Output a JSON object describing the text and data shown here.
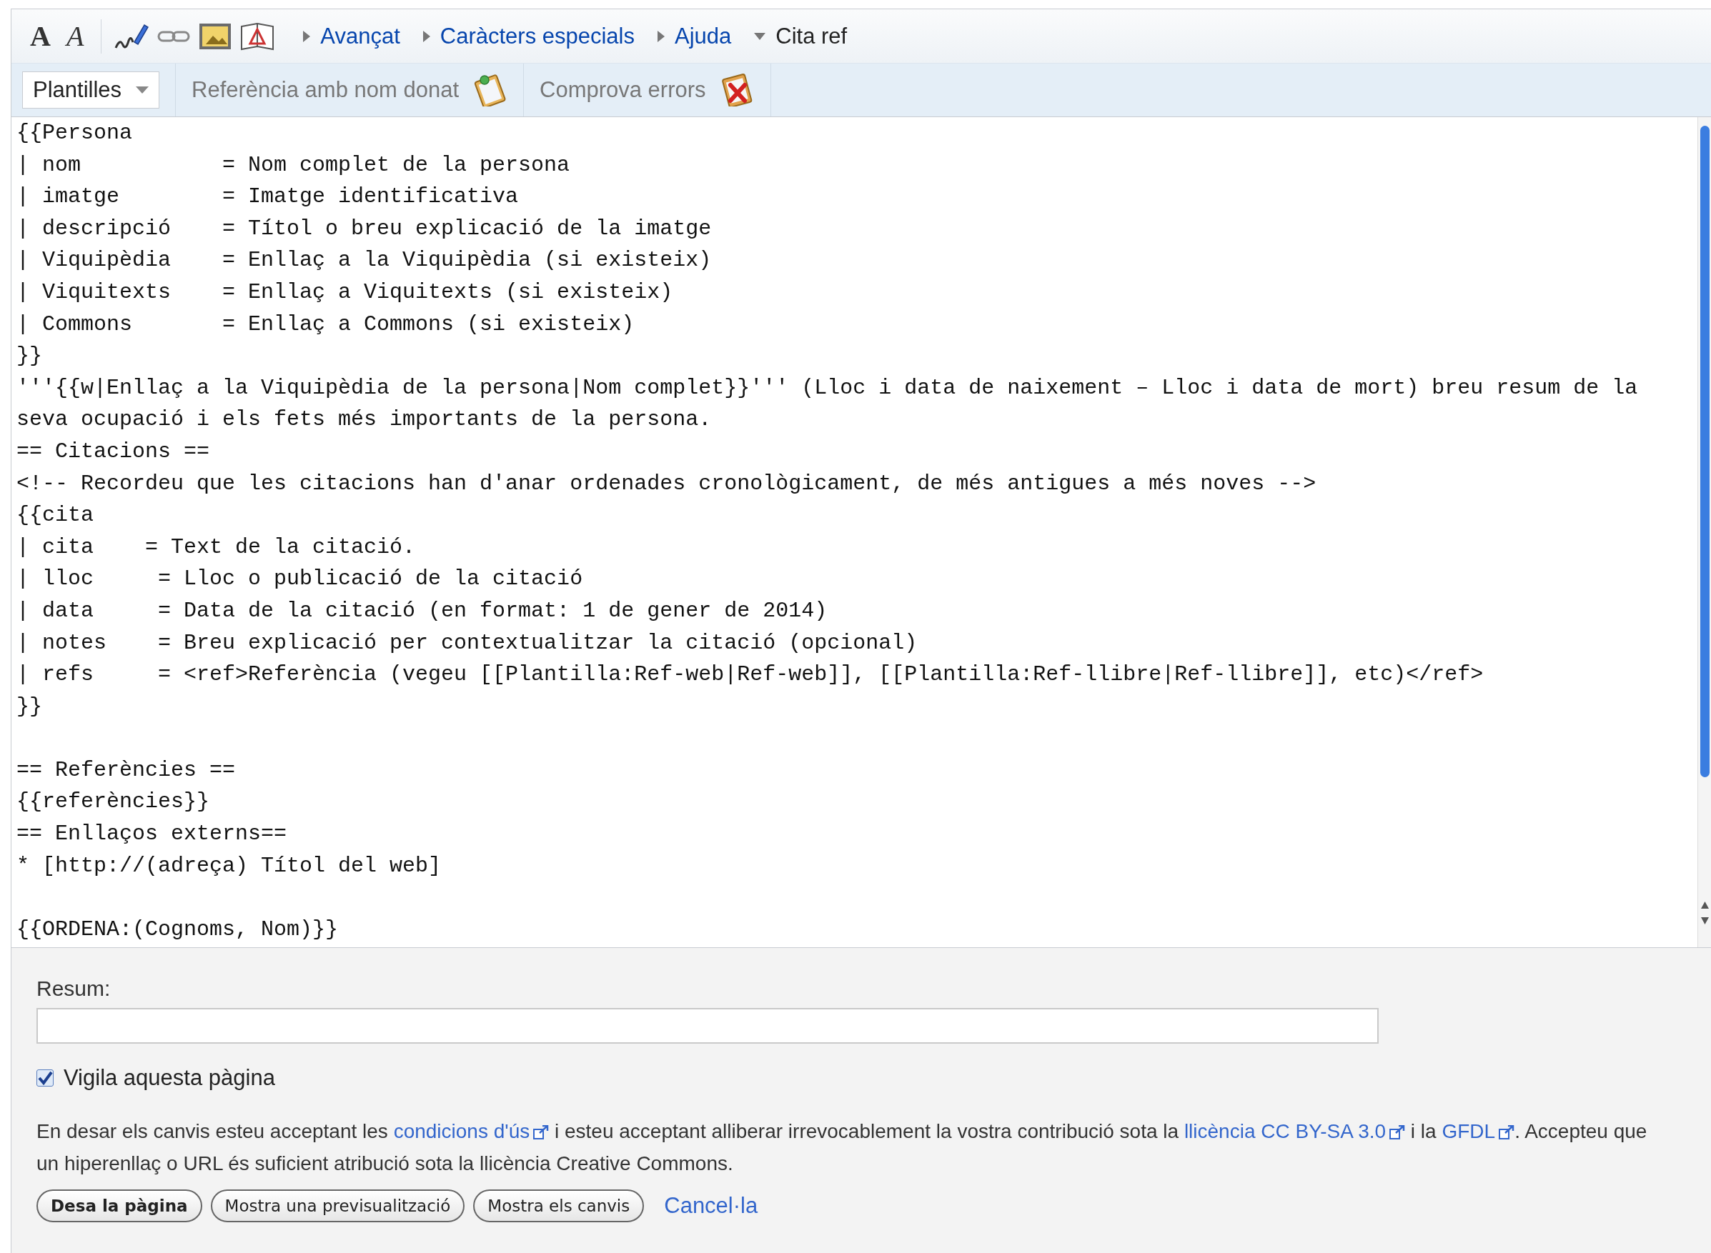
{
  "toolbar": {
    "format_buttons": [
      {
        "label": "A",
        "kind": "bold"
      },
      {
        "label": "A",
        "kind": "italic"
      }
    ],
    "sections": [
      {
        "label": "Avançat",
        "expanded": false
      },
      {
        "label": "Caràcters especials",
        "expanded": false
      },
      {
        "label": "Ajuda",
        "expanded": false
      },
      {
        "label": "Cita ref",
        "expanded": true
      }
    ],
    "templates_menu": {
      "label": "Plantilles"
    },
    "tools": [
      {
        "label": "Referència amb nom donat",
        "kind": "reference"
      },
      {
        "label": "Comprova errors",
        "kind": "check"
      }
    ]
  },
  "source": {
    "lines": [
      {
        "kind": "code",
        "text": "{{Persona"
      },
      {
        "kind": "code",
        "text": "| nom           = Nom complet de la persona"
      },
      {
        "kind": "code",
        "text": "| imatge        = Imatge identificativa"
      },
      {
        "kind": "code",
        "text": "| descripció    = Títol o breu explicació de la imatge"
      },
      {
        "kind": "code",
        "text": "| Viquipèdia    = Enllaç a la Viquipèdia (si existeix)"
      },
      {
        "kind": "code",
        "text": "| Viquitexts    = Enllaç a Viquitexts (si existeix)"
      },
      {
        "kind": "code",
        "text": "| Commons       = Enllaç a Commons (si existeix)"
      },
      {
        "kind": "code",
        "text": "}}"
      },
      {
        "kind": "code",
        "text": "'''{{w|Enllaç a la Viquipèdia de la persona|Nom complet}}''' (Lloc i data de naixement – Lloc i data de mort) breu resum de la"
      },
      {
        "kind": "code",
        "text": "seva ocupació i els fets més importants de la persona."
      },
      {
        "kind": "code",
        "text": "== Citacions =="
      },
      {
        "kind": "code",
        "text": "<!-- Recordeu que les citacions han d'anar ordenades cronològicament, de més antigues a més noves -->"
      },
      {
        "kind": "code",
        "text": "{{cita"
      },
      {
        "kind": "code",
        "text": "| cita    = Text de la citació."
      },
      {
        "kind": "code",
        "text": "| lloc     = Lloc o publicació de la citació"
      },
      {
        "kind": "code",
        "text": "| data     = Data de la citació (en format: 1 de gener de 2014)"
      },
      {
        "kind": "code",
        "text": "| notes    = Breu explicació per contextualitzar la citació (opcional)"
      },
      {
        "kind": "code",
        "text": "| refs     = <ref>Referència (vegeu [[Plantilla:Ref-web|Ref-web]], [[Plantilla:Ref-llibre|Ref-llibre]], etc)</ref>"
      },
      {
        "kind": "code",
        "text": "}}"
      },
      {
        "kind": "blank"
      },
      {
        "kind": "code",
        "text": "== Referències =="
      },
      {
        "kind": "code",
        "text": "{{referències}}"
      },
      {
        "kind": "code",
        "text": "== Enllaços externs=="
      },
      {
        "kind": "code",
        "text": "* [http://(adreça) Títol del web]"
      },
      {
        "kind": "blank"
      },
      {
        "kind": "code",
        "text": "{{ORDENA:(Cognoms, Nom)}}"
      }
    ]
  },
  "summary": {
    "label": "Resum:"
  },
  "watch": {
    "label": "Vigila aquesta pàgina",
    "checked": true
  },
  "license": [
    {
      "kind": "text",
      "text": "En desar els canvis esteu acceptant les "
    },
    {
      "kind": "link",
      "text": "condicions d'ús"
    },
    {
      "kind": "text",
      "text": " i esteu acceptant alliberar irrevocablement la vostra contribució sota la "
    },
    {
      "kind": "link",
      "text": "llicència CC BY-SA 3.0"
    },
    {
      "kind": "text",
      "text": " i la "
    },
    {
      "kind": "link",
      "text": "GFDL"
    },
    {
      "kind": "text",
      "text": ". Accepteu que un hiperenllaç o URL és suficient atribució sota la llicència Creative Commons."
    }
  ],
  "buttons": [
    {
      "label": "Desa la pàgina",
      "primary": true
    },
    {
      "label": "Mostra una previsualització",
      "primary": false
    },
    {
      "label": "Mostra els canvis",
      "primary": false
    }
  ],
  "cancel": {
    "label": "Cancel·la"
  }
}
